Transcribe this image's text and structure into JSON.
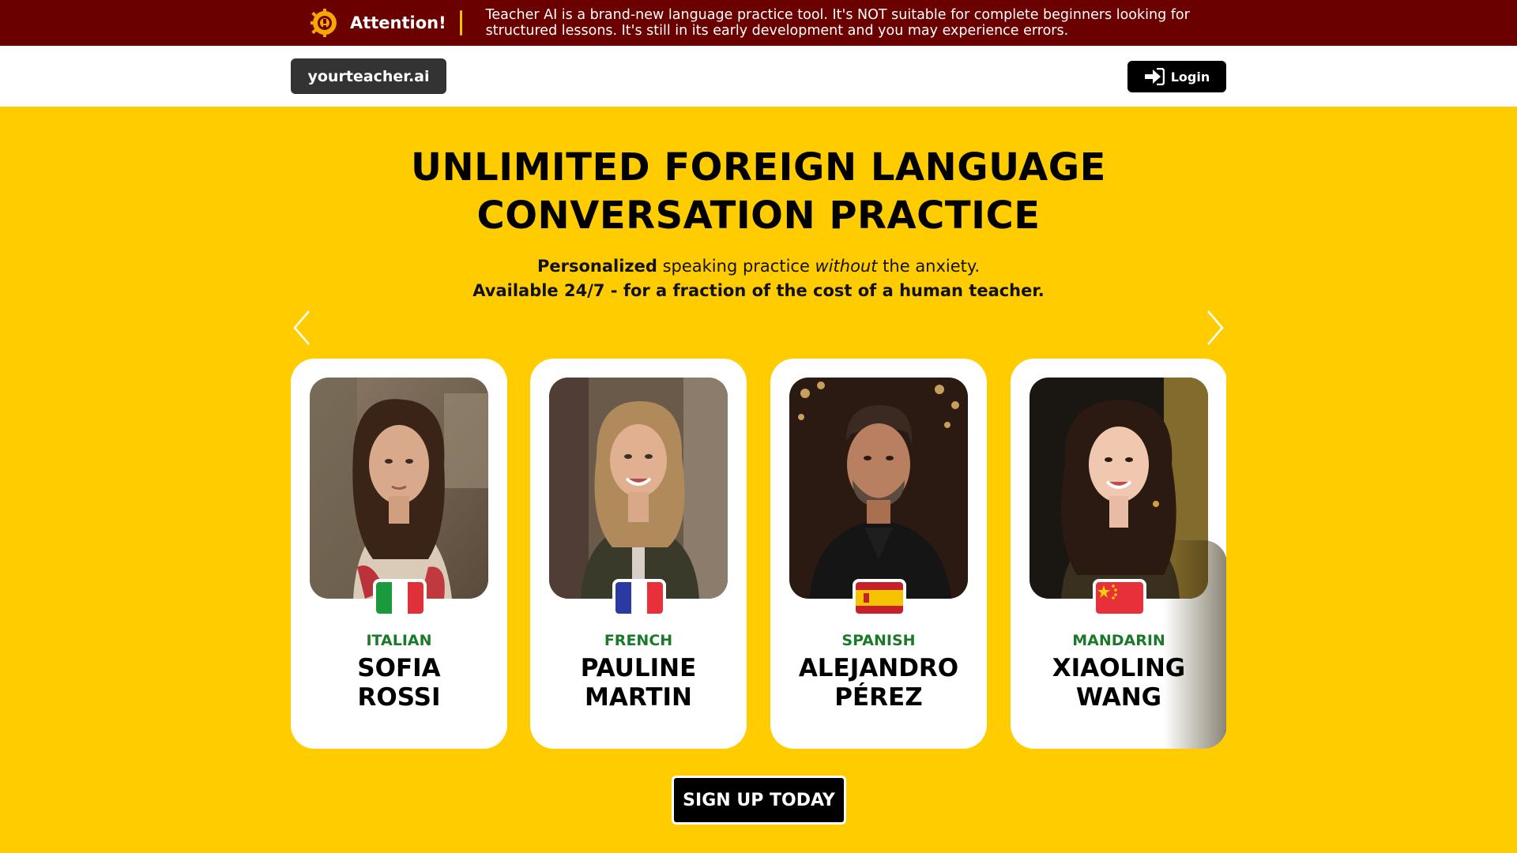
{
  "banner": {
    "title": "Attention!",
    "message": "Teacher AI is a brand-new language practice tool. It's NOT suitable for complete beginners looking for structured lessons. It's still in its early development and you may experience errors.",
    "icon": "warning-gear-icon"
  },
  "nav": {
    "logo": "yourteacher.ai",
    "login_label": "Login",
    "login_icon": "sign-in-icon"
  },
  "hero": {
    "title_line1": "UNLIMITED FOREIGN LANGUAGE",
    "title_line2": "CONVERSATION PRACTICE",
    "sub_bold": "Personalized",
    "sub_mid": " speaking practice ",
    "sub_italic": "without",
    "sub_end": " the anxiety.",
    "sub_line2": "Available 24/7 - for a fraction of the cost of a human teacher."
  },
  "carousel": {
    "prev_icon": "chevron-left-icon",
    "next_icon": "chevron-right-icon",
    "teachers": [
      {
        "language": "ITALIAN",
        "first": "SOFIA",
        "last": "ROSSI",
        "flag": "italy-flag"
      },
      {
        "language": "FRENCH",
        "first": "PAULINE",
        "last": "MARTIN",
        "flag": "france-flag"
      },
      {
        "language": "SPANISH",
        "first": "ALEJANDRO",
        "last": "PÉREZ",
        "flag": "spain-flag"
      },
      {
        "language": "MANDARIN",
        "first": "XIAOLING",
        "last": "WANG",
        "flag": "china-flag"
      }
    ]
  },
  "cta": {
    "signup_label": "SIGN UP TODAY"
  },
  "colors": {
    "banner_bg": "#6b0000",
    "accent_yellow": "#ffcc00",
    "language_green": "#1a7a2a"
  }
}
